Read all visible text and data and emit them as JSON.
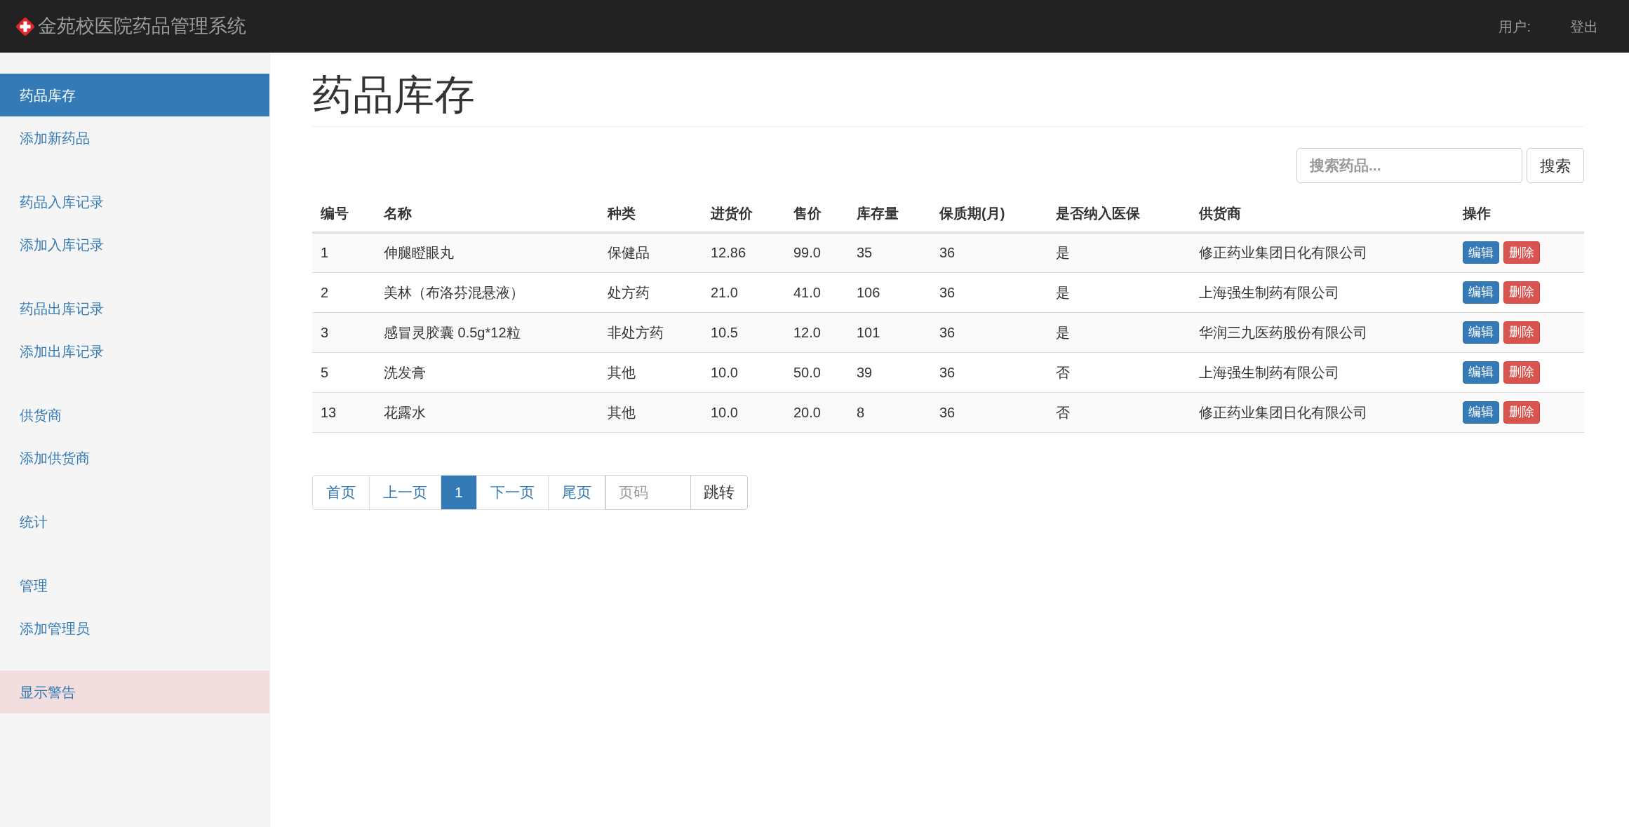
{
  "navbar": {
    "brand": "金苑校医院药品管理系统",
    "user_label": "用户:",
    "logout": "登出"
  },
  "sidebar": {
    "groups": [
      {
        "items": [
          {
            "label": "药品库存",
            "selected": true,
            "kind": "link"
          },
          {
            "label": "添加新药品",
            "selected": false,
            "kind": "link"
          }
        ]
      },
      {
        "items": [
          {
            "label": "药品入库记录",
            "selected": false,
            "kind": "link"
          },
          {
            "label": "添加入库记录",
            "selected": false,
            "kind": "link"
          }
        ]
      },
      {
        "items": [
          {
            "label": "药品出库记录",
            "selected": false,
            "kind": "link"
          },
          {
            "label": "添加出库记录",
            "selected": false,
            "kind": "link"
          }
        ]
      },
      {
        "items": [
          {
            "label": "供货商",
            "selected": false,
            "kind": "link"
          },
          {
            "label": "添加供货商",
            "selected": false,
            "kind": "link"
          }
        ]
      },
      {
        "items": [
          {
            "label": "统计",
            "selected": false,
            "kind": "link"
          }
        ]
      },
      {
        "items": [
          {
            "label": "管理",
            "selected": false,
            "kind": "link"
          },
          {
            "label": "添加管理员",
            "selected": false,
            "kind": "link"
          }
        ]
      },
      {
        "items": [
          {
            "label": "显示警告",
            "selected": false,
            "kind": "alert"
          }
        ]
      }
    ]
  },
  "page_title": "药品库存",
  "search": {
    "placeholder": "搜索药品...",
    "button": "搜索"
  },
  "table": {
    "columns": [
      "编号",
      "名称",
      "种类",
      "进货价",
      "售价",
      "库存量",
      "保质期(月)",
      "是否纳入医保",
      "供货商",
      "操作"
    ],
    "rows": [
      {
        "cells": [
          "1",
          "伸腿瞪眼丸",
          "保健品",
          "12.86",
          "99.0",
          "35",
          "36",
          "是",
          "修正药业集团日化有限公司"
        ],
        "actions": [
          {
            "label": "编辑",
            "kind": "primary"
          },
          {
            "label": "删除",
            "kind": "danger"
          }
        ]
      },
      {
        "cells": [
          "2",
          "美林（布洛芬混悬液）",
          "处方药",
          "21.0",
          "41.0",
          "106",
          "36",
          "是",
          "上海强生制药有限公司"
        ],
        "actions": [
          {
            "label": "编辑",
            "kind": "primary"
          },
          {
            "label": "删除",
            "kind": "danger"
          }
        ]
      },
      {
        "cells": [
          "3",
          "感冒灵胶囊 0.5g*12粒",
          "非处方药",
          "10.5",
          "12.0",
          "101",
          "36",
          "是",
          "华润三九医药股份有限公司"
        ],
        "actions": [
          {
            "label": "编辑",
            "kind": "primary"
          },
          {
            "label": "删除",
            "kind": "danger"
          }
        ]
      },
      {
        "cells": [
          "5",
          "洗发膏",
          "其他",
          "10.0",
          "50.0",
          "39",
          "36",
          "否",
          "上海强生制药有限公司"
        ],
        "actions": [
          {
            "label": "编辑",
            "kind": "primary"
          },
          {
            "label": "删除",
            "kind": "danger"
          }
        ]
      },
      {
        "cells": [
          "13",
          "花露水",
          "其他",
          "10.0",
          "20.0",
          "8",
          "36",
          "否",
          "修正药业集团日化有限公司"
        ],
        "actions": [
          {
            "label": "编辑",
            "kind": "primary"
          },
          {
            "label": "删除",
            "kind": "danger"
          }
        ]
      }
    ]
  },
  "pagination": {
    "items": [
      {
        "label": "首页",
        "selected": false
      },
      {
        "label": "上一页",
        "selected": false
      },
      {
        "label": "1",
        "selected": true
      },
      {
        "label": "下一页",
        "selected": false
      },
      {
        "label": "尾页",
        "selected": false
      }
    ],
    "page_input": {
      "placeholder": "页码"
    },
    "jump": "跳转"
  }
}
